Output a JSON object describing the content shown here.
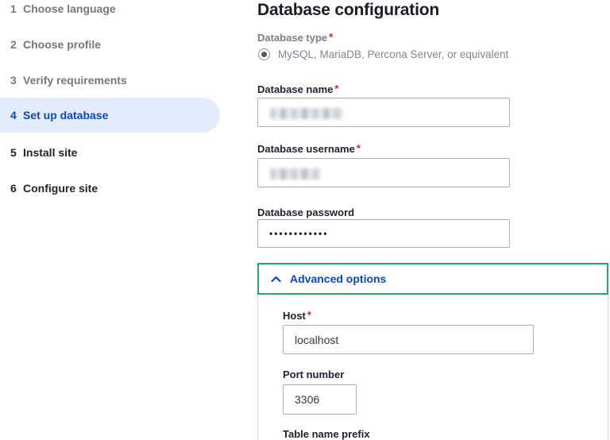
{
  "sidebar": {
    "steps": [
      {
        "number": "1",
        "label": "Choose language",
        "state": "done"
      },
      {
        "number": "2",
        "label": "Choose profile",
        "state": "done"
      },
      {
        "number": "3",
        "label": "Verify requirements",
        "state": "done"
      },
      {
        "number": "4",
        "label": "Set up database",
        "state": "active"
      },
      {
        "number": "5",
        "label": "Install site",
        "state": "upcoming"
      },
      {
        "number": "6",
        "label": "Configure site",
        "state": "upcoming"
      }
    ]
  },
  "main": {
    "heading": "Database configuration",
    "required_marker": "*",
    "database_type": {
      "label": "Database type",
      "option_label": "MySQL, MariaDB, Percona Server, or equivalent",
      "selected": true
    },
    "database_name": {
      "label": "Database name",
      "value_redacted": true
    },
    "database_username": {
      "label": "Database username",
      "value_redacted": true
    },
    "database_password": {
      "label": "Database password",
      "value": "••••••••••••"
    },
    "advanced": {
      "toggle_label": "Advanced options",
      "expanded": true,
      "host": {
        "label": "Host",
        "value": "localhost"
      },
      "port": {
        "label": "Port number",
        "value": "3306"
      },
      "table_prefix": {
        "label": "Table name prefix"
      }
    }
  },
  "colors": {
    "accent_blue": "#0a46c8",
    "active_step_bg": "#e4ecfc",
    "focus_green": "#26a769",
    "required_red": "#d72222"
  }
}
